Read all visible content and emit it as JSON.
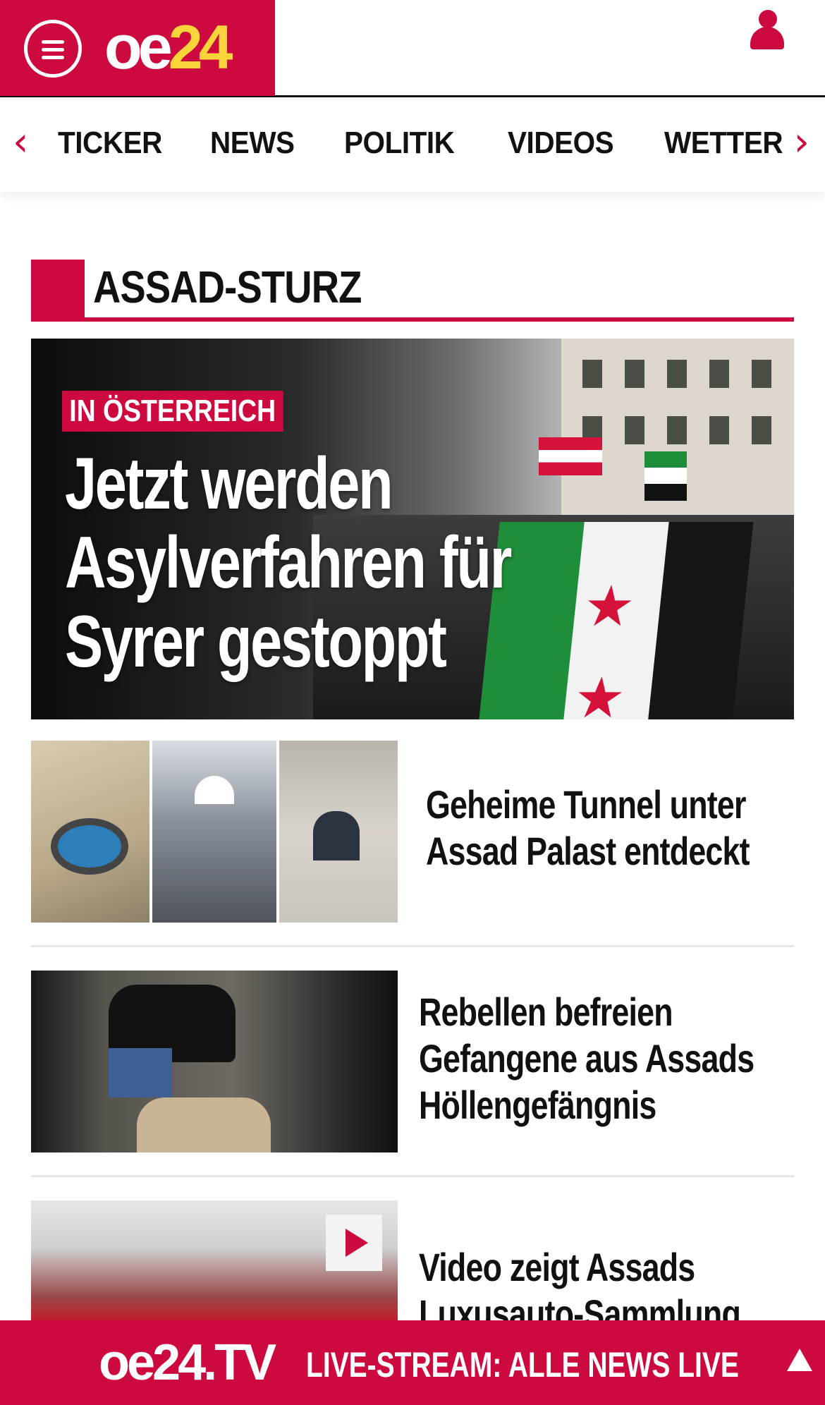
{
  "header": {
    "logo_oe": "oe",
    "logo_num": "24"
  },
  "nav": {
    "items": [
      {
        "label": "TICKER"
      },
      {
        "label": "NEWS"
      },
      {
        "label": "POLITIK"
      },
      {
        "label": "VIDEOS"
      },
      {
        "label": "WETTER"
      }
    ],
    "left_arrow": "‹",
    "right_arrow": "›"
  },
  "section": {
    "title": "ASSAD-STURZ"
  },
  "hero": {
    "kicker": "IN ÖSTERREICH",
    "headline": "Jetzt werden Asylverfahren für Syrer gestoppt"
  },
  "articles": [
    {
      "title": "Geheime Tunnel unter Assad Palast entdeckt"
    },
    {
      "title": "Rebellen befreien Gefangene aus Assads Höllengefängnis"
    },
    {
      "title": "Video zeigt Assads Luxusauto-Sammlung"
    }
  ],
  "bottom_bar": {
    "logo": "oe24.TV",
    "text": "LIVE-STREAM:  ALLE NEWS LIVE"
  },
  "colors": {
    "brand_red": "#cc0a3f",
    "logo_yellow": "#f7d43a"
  },
  "icons": {
    "menu": "hamburger-menu-icon",
    "user": "user-icon",
    "play": "play-icon",
    "scroll_top": "arrow-up-icon"
  }
}
